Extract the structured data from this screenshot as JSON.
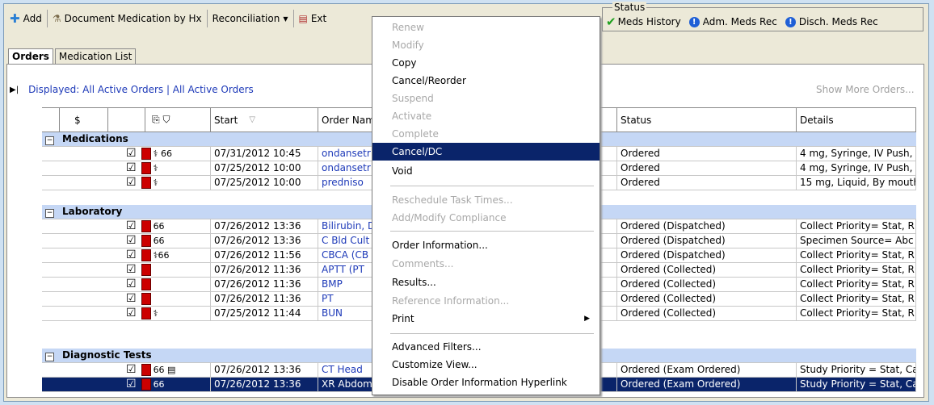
{
  "toolbar": {
    "add_label": "Add",
    "doc_med_label": "Document Medication by Hx",
    "reconciliation_label": "Reconciliation",
    "ext_label": "Ext"
  },
  "status": {
    "title": "Status",
    "items": [
      {
        "label": "Meds History",
        "icon": "check-icon"
      },
      {
        "label": "Adm. Meds Rec",
        "icon": "info-icon"
      },
      {
        "label": "Disch. Meds Rec",
        "icon": "info-icon"
      }
    ]
  },
  "tabs": [
    {
      "label": "Orders",
      "active": true
    },
    {
      "label": "Medication List",
      "active": false
    }
  ],
  "displayed": {
    "text": "Displayed: All Active Orders | All Active Orders",
    "show_more": "Show More Orders..."
  },
  "columns": {
    "dollar": "$",
    "start": "Start",
    "order_name": "Order Nam",
    "status": "Status",
    "details": "Details"
  },
  "groups": [
    {
      "name": "Medications",
      "rows": [
        {
          "start": "07/31/2012 10:45",
          "order": "ondansetr",
          "status": "Ordered",
          "details": "4 mg, Syringe, IV Push,"
        },
        {
          "start": "07/25/2012 10:00",
          "order": "ondansetr",
          "status": "Ordered",
          "details": "4 mg, Syringe, IV Push,"
        },
        {
          "start": "07/25/2012 10:00",
          "order": "predniso",
          "status": "Ordered",
          "details": "15 mg, Liquid, By mouth"
        }
      ]
    },
    {
      "name": "Laboratory",
      "rows": [
        {
          "start": "07/26/2012 13:36",
          "order": "Bilirubin, D",
          "status": "Ordered (Dispatched)",
          "details": "Collect Priority= Stat, R"
        },
        {
          "start": "07/26/2012 13:36",
          "order": "C Bld Cult",
          "status": "Ordered (Dispatched)",
          "details": "Specimen Source= Abc"
        },
        {
          "start": "07/26/2012 11:56",
          "order": "CBCA (CB",
          "status": "Ordered (Dispatched)",
          "details": "Collect Priority= Stat, R"
        },
        {
          "start": "07/26/2012 11:36",
          "order": "APTT (PT",
          "status": "Ordered (Collected)",
          "details": "Collect Priority= Stat, R"
        },
        {
          "start": "07/26/2012 11:36",
          "order": "BMP",
          "status": "Ordered (Collected)",
          "details": "Collect Priority= Stat, R"
        },
        {
          "start": "07/26/2012 11:36",
          "order": "PT",
          "status": "Ordered (Collected)",
          "details": "Collect Priority= Stat, R"
        },
        {
          "start": "07/25/2012 11:44",
          "order": "BUN",
          "status": "Ordered (Collected)",
          "details": "Collect Priority= Stat, R"
        }
      ]
    },
    {
      "name": "Diagnostic Tests",
      "rows": [
        {
          "start": "07/26/2012 13:36",
          "order": "CT Head",
          "status": "Ordered (Exam Ordered)",
          "details": "Study Priority = Stat, Ca"
        },
        {
          "start": "07/26/2012 13:36",
          "order": "XR Abdom",
          "status": "Ordered (Exam Ordered)",
          "details": "Study Priority = Stat, Ca",
          "selected": true
        }
      ]
    }
  ],
  "context_menu": {
    "items": [
      {
        "label": "Renew",
        "disabled": true
      },
      {
        "label": "Modify",
        "disabled": true
      },
      {
        "label": "Copy",
        "disabled": false
      },
      {
        "label": "Cancel/Reorder",
        "disabled": false
      },
      {
        "label": "Suspend",
        "disabled": true
      },
      {
        "label": "Activate",
        "disabled": true
      },
      {
        "label": "Complete",
        "disabled": true
      },
      {
        "label": "Cancel/DC",
        "disabled": false,
        "highlighted": true
      },
      {
        "label": "Void",
        "disabled": false
      },
      {
        "label": "Reschedule Task Times...",
        "disabled": true
      },
      {
        "label": "Add/Modify Compliance",
        "disabled": true
      },
      {
        "label": "Order Information...",
        "disabled": false
      },
      {
        "label": "Comments...",
        "disabled": true
      },
      {
        "label": "Results...",
        "disabled": false
      },
      {
        "label": "Reference Information...",
        "disabled": true
      },
      {
        "label": "Print",
        "disabled": false,
        "submenu": true
      },
      {
        "label": "Advanced Filters...",
        "disabled": false
      },
      {
        "label": "Customize View...",
        "disabled": false
      },
      {
        "label": "Disable Order Information Hyperlink",
        "disabled": false
      }
    ]
  },
  "colors": {
    "group_row": "#c5d7f5",
    "selection": "#0a246a",
    "link": "#1d39b8"
  }
}
